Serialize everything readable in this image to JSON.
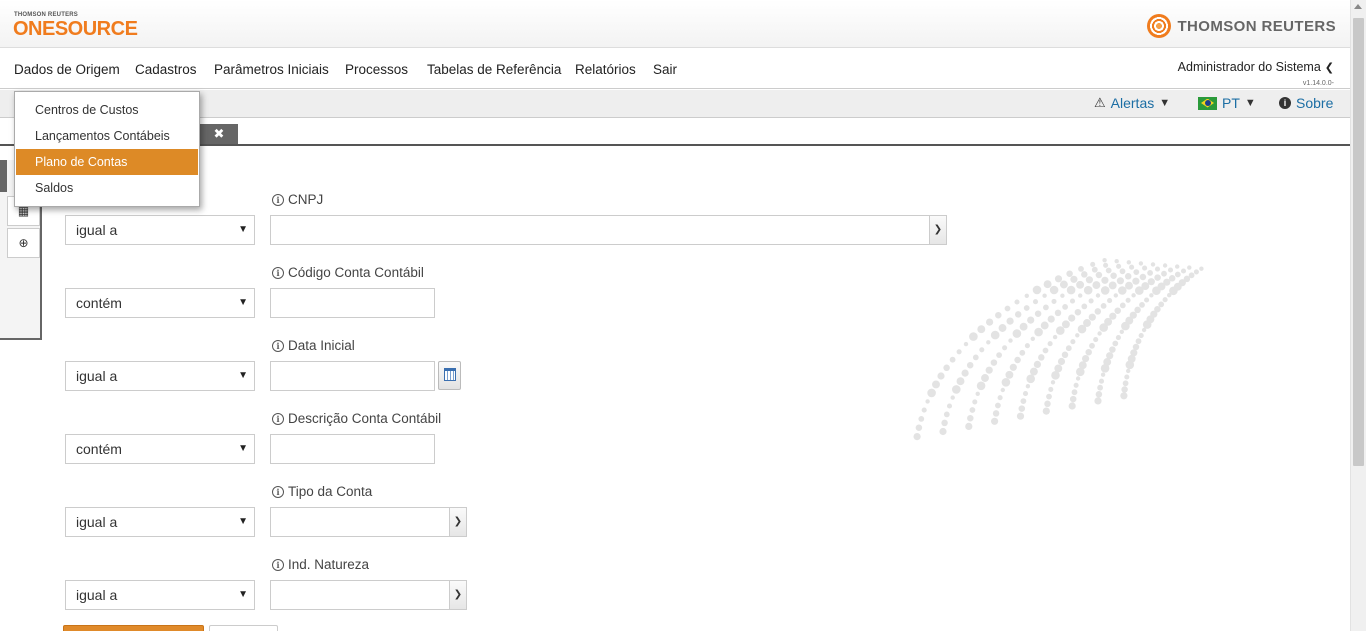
{
  "header": {
    "logo_small": "THOMSON REUTERS",
    "logo_big": "ONESOURCE",
    "brand_right": "THOMSON REUTERS"
  },
  "menu": {
    "items": [
      {
        "label": "Dados de Origem"
      },
      {
        "label": "Cadastros"
      },
      {
        "label": "Parâmetros Iniciais"
      },
      {
        "label": "Processos"
      },
      {
        "label": "Tabelas de Referência"
      },
      {
        "label": "Relatórios"
      },
      {
        "label": "Sair"
      }
    ],
    "user": "Administrador do Sistema",
    "version": "v1.14.0.0-"
  },
  "toolbar": {
    "alerts": "Alertas",
    "language": "PT",
    "about": "Sobre"
  },
  "dropdown": {
    "items": [
      {
        "label": "Centros de Custos",
        "active": false
      },
      {
        "label": "Lançamentos Contábeis",
        "active": false
      },
      {
        "label": "Plano de Contas",
        "active": true
      },
      {
        "label": "Saldos",
        "active": false
      }
    ]
  },
  "form": {
    "fields": [
      {
        "label": "CNPJ",
        "operator": "igual a",
        "type": "combo-wide"
      },
      {
        "label": "Código Conta Contábil",
        "operator": "contém",
        "type": "text"
      },
      {
        "label": "Data Inicial",
        "operator": "igual a",
        "type": "date"
      },
      {
        "label": "Descrição Conta Contábil",
        "operator": "contém",
        "type": "text"
      },
      {
        "label": "Tipo da Conta",
        "operator": "igual a",
        "type": "combo"
      },
      {
        "label": "Ind. Natureza",
        "operator": "igual a",
        "type": "combo"
      }
    ]
  },
  "colors": {
    "brand_orange": "#f07c1e",
    "menu_highlight": "#dd8a26",
    "link_blue": "#1c6ea4"
  }
}
